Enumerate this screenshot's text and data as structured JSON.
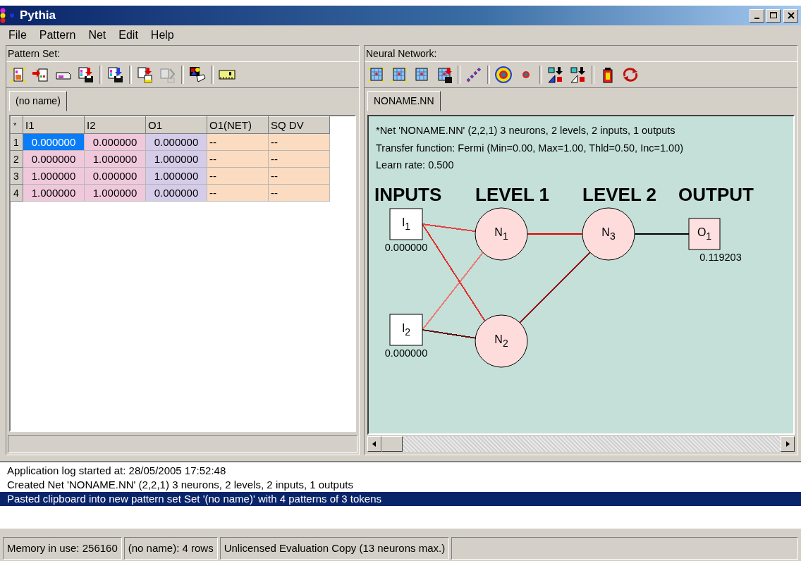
{
  "window": {
    "title": "Pythia"
  },
  "menu": [
    {
      "label": "File"
    },
    {
      "label": "Pattern"
    },
    {
      "label": "Net"
    },
    {
      "label": "Edit"
    },
    {
      "label": "Help"
    }
  ],
  "pattern_set": {
    "caption": "Pattern Set:",
    "tabs": [
      {
        "label": "(no name)",
        "selected": true
      }
    ],
    "table": {
      "corner": "*",
      "columns": [
        {
          "label": "I1",
          "kind": "input"
        },
        {
          "label": "I2",
          "kind": "input"
        },
        {
          "label": "O1",
          "kind": "output"
        },
        {
          "label": "O1(NET)",
          "kind": "computed"
        },
        {
          "label": "SQ DV",
          "kind": "computed"
        }
      ],
      "rows": [
        {
          "header": "1",
          "cells": [
            {
              "text": "0.000000",
              "selected": true
            },
            {
              "text": "0.000000",
              "selected": false
            },
            {
              "text": "0.000000",
              "selected": false
            },
            {
              "text": "--",
              "selected": false
            },
            {
              "text": "--",
              "selected": false
            }
          ]
        },
        {
          "header": "2",
          "cells": [
            {
              "text": "0.000000",
              "selected": false
            },
            {
              "text": "1.000000",
              "selected": false
            },
            {
              "text": "1.000000",
              "selected": false
            },
            {
              "text": "--",
              "selected": false
            },
            {
              "text": "--",
              "selected": false
            }
          ]
        },
        {
          "header": "3",
          "cells": [
            {
              "text": "1.000000",
              "selected": false
            },
            {
              "text": "0.000000",
              "selected": false
            },
            {
              "text": "1.000000",
              "selected": false
            },
            {
              "text": "--",
              "selected": false
            },
            {
              "text": "--",
              "selected": false
            }
          ]
        },
        {
          "header": "4",
          "cells": [
            {
              "text": "1.000000",
              "selected": false
            },
            {
              "text": "1.000000",
              "selected": false
            },
            {
              "text": "0.000000",
              "selected": false
            },
            {
              "text": "--",
              "selected": false
            },
            {
              "text": "--",
              "selected": false
            }
          ]
        }
      ]
    }
  },
  "neural_network": {
    "caption": "Neural Network:",
    "tabs": [
      {
        "label": "NONAME.NN",
        "selected": true
      }
    ],
    "info": [
      "*Net 'NONAME.NN' (2,2,1) 3 neurons, 2 levels, 2 inputs, 1 outputs",
      "Transfer function: Fermi (Min=0.00, Max=1.00, Thld=0.50, Inc=1.00)",
      "Learn rate: 0.500"
    ],
    "layers": [
      {
        "heading": "INPUTS",
        "kind": "input",
        "nodes": [
          {
            "label": "I$_{1}$",
            "value": "0.000000"
          },
          {
            "label": "I$_{2}$",
            "value": "0.000000"
          }
        ]
      },
      {
        "heading": "LEVEL 1",
        "kind": "neuron",
        "nodes": [
          {
            "label": "N$_{1}$",
            "links": [
              {
                "color": "#e84040"
              },
              {
                "color": "#f07878"
              }
            ]
          },
          {
            "label": "N$_{2}$",
            "links": [
              {
                "color": "#e03030"
              },
              {
                "color": "#601010"
              }
            ]
          }
        ]
      },
      {
        "heading": "LEVEL 2",
        "kind": "neuron",
        "nodes": [
          {
            "label": "N$_{3}$",
            "links": [
              {
                "color": "#e00000"
              },
              {
                "color": "#902020"
              }
            ]
          }
        ]
      },
      {
        "heading": "OUTPUT",
        "kind": "output",
        "nodes": [
          {
            "label": "O$_{1}$",
            "value": "0.119203",
            "links": [
              {
                "color": "#000000"
              }
            ]
          }
        ]
      }
    ]
  },
  "log": [
    {
      "text": "Application log started at: 28/05/2005 17:52:48",
      "selected": false
    },
    {
      "text": "Created Net 'NONAME.NN' (2,2,1) 3 neurons, 2 levels, 2 inputs, 1 outputs",
      "selected": false
    },
    {
      "text": "Pasted clipboard into new pattern set Set '(no name)' with 4 patterns of 3 tokens",
      "selected": true
    }
  ],
  "status_bar": [
    "Memory in use: 256160",
    "(no name): 4 rows",
    "Unlicensed Evaluation Copy (13 neurons max.)"
  ]
}
